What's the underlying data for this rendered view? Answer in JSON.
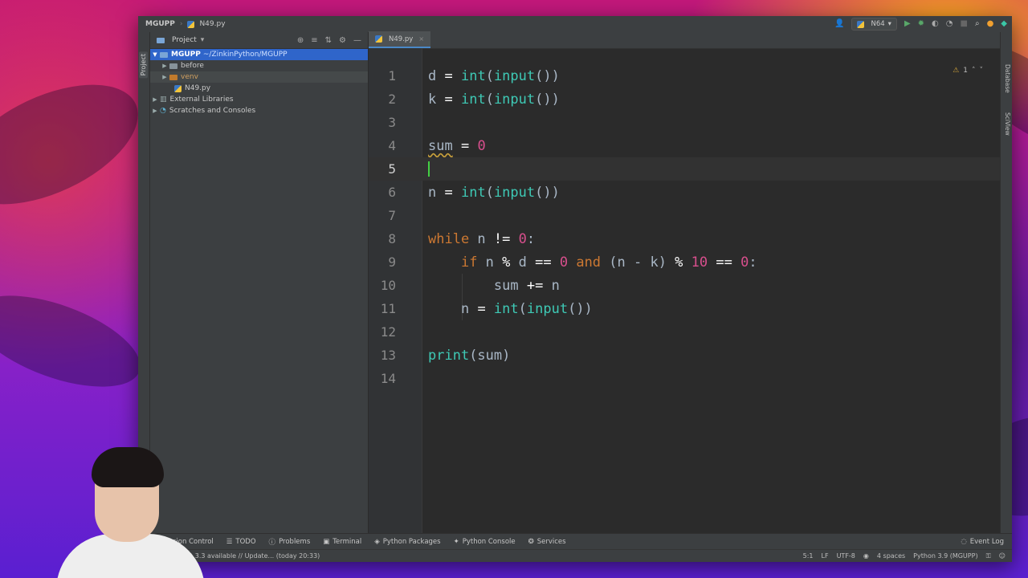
{
  "window": {
    "project_name": "MGUPP",
    "file_name": "N49.py",
    "run_config": "N64"
  },
  "left_strip": {
    "label": "Project"
  },
  "project_panel": {
    "header": "Project",
    "tree": [
      {
        "label": "MGUPP",
        "path": "~/ZinkinPython/MGUPP"
      },
      {
        "label": "before"
      },
      {
        "label": "venv"
      },
      {
        "label": "N49.py"
      },
      {
        "label": "External Libraries"
      },
      {
        "label": "Scratches and Consoles"
      }
    ]
  },
  "editor": {
    "tab": "N49.py",
    "warning_count": "1",
    "line_numbers": [
      "1",
      "2",
      "3",
      "4",
      "5",
      "6",
      "7",
      "8",
      "9",
      "10",
      "11",
      "12",
      "13",
      "14"
    ],
    "code": {
      "l1": {
        "var": "d",
        "eq": " = ",
        "fn": "int",
        "fn2": "input",
        "tail": "())"
      },
      "l2": {
        "var": "k",
        "eq": " = ",
        "fn": "int",
        "fn2": "input",
        "tail": "())"
      },
      "l4": {
        "var": "sum",
        "eq": " = ",
        "num": "0"
      },
      "l6": {
        "var": "n",
        "eq": " = ",
        "fn": "int",
        "fn2": "input",
        "tail": "())"
      },
      "l8": {
        "kw": "while",
        "rest1": " n ",
        "op": "!=",
        "num": " 0",
        "end": ":"
      },
      "l9": {
        "kw": "if",
        "a": " n ",
        "op1": "%",
        "b": " d ",
        "op2": "==",
        "n1": " 0 ",
        "kw2": "and",
        "c": " (n - k) ",
        "op3": "%",
        "n2": " 10 ",
        "op4": "==",
        "n3": " 0",
        "end": ":"
      },
      "l10": {
        "a": "sum ",
        "op": "+=",
        "b": " n"
      },
      "l11": {
        "var": "n",
        "eq": " = ",
        "fn": "int",
        "fn2": "input",
        "tail": "())"
      },
      "l13": {
        "fn": "print",
        "tail": "(sum)"
      }
    }
  },
  "right_strip": {
    "labels": [
      "Database",
      "SciView"
    ]
  },
  "tool_windows": [
    "Version Control",
    "TODO",
    "Problems",
    "Terminal",
    "Python Packages",
    "Python Console",
    "Services"
  ],
  "event_log": "Event Log",
  "status": {
    "update_msg": "21.3.3 available // Update... (today 20:33)",
    "position": "5:1",
    "line_sep": "LF",
    "encoding": "UTF-8",
    "indent": "4 spaces",
    "interpreter": "Python 3.9 (MGUPP)"
  }
}
